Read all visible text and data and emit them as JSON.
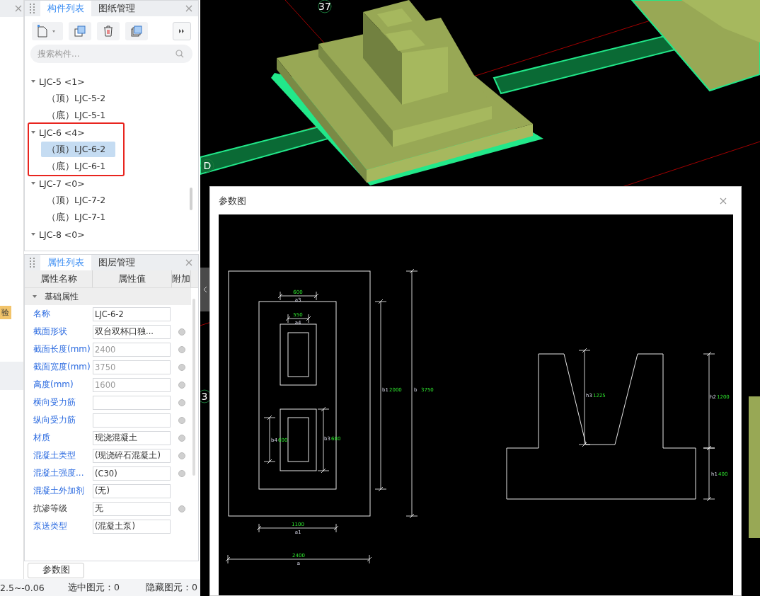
{
  "left_strip": {
    "badge": "验"
  },
  "component_panel": {
    "tabs": [
      {
        "label": "构件列表",
        "selected": true
      },
      {
        "label": "图纸管理",
        "selected": false
      }
    ],
    "search": {
      "placeholder": "搜索构件..."
    },
    "tree": [
      {
        "label": "LJC-5 <1>",
        "expanded": true,
        "marked": false,
        "children": [
          {
            "label": "（顶）LJC-5-2",
            "selected": false
          },
          {
            "label": "（底）LJC-5-1",
            "selected": false
          }
        ]
      },
      {
        "label": "LJC-6 <4>",
        "expanded": true,
        "marked": true,
        "children": [
          {
            "label": "（顶）LJC-6-2",
            "selected": true
          },
          {
            "label": "（底）LJC-6-1",
            "selected": false
          }
        ]
      },
      {
        "label": "LJC-7 <0>",
        "expanded": true,
        "marked": false,
        "children": [
          {
            "label": "（顶）LJC-7-2",
            "selected": false
          },
          {
            "label": "（底）LJC-7-1",
            "selected": false
          }
        ]
      },
      {
        "label": "LJC-8 <0>",
        "expanded": true,
        "marked": false
      }
    ]
  },
  "property_panel": {
    "tabs": [
      {
        "label": "属性列表",
        "selected": true
      },
      {
        "label": "图层管理",
        "selected": false
      }
    ],
    "columns": [
      "属性名称",
      "属性值",
      "附加"
    ],
    "group": {
      "label": "基础属性",
      "expanded": true
    },
    "rows": [
      {
        "name": "名称",
        "value": "LJC-6-2",
        "public": true,
        "disabled": false,
        "attached": false
      },
      {
        "name": "截面形状",
        "value": "双台双杯口独...",
        "public": true,
        "disabled": false,
        "attached": true
      },
      {
        "name": "截面长度(mm)",
        "value": "2400",
        "public": true,
        "disabled": true,
        "attached": true
      },
      {
        "name": "截面宽度(mm)",
        "value": "3750",
        "public": true,
        "disabled": true,
        "attached": true
      },
      {
        "name": "高度(mm)",
        "value": "1600",
        "public": true,
        "disabled": true,
        "attached": true
      },
      {
        "name": "横向受力筋",
        "public": true,
        "disabled": false,
        "attached": true
      },
      {
        "name": "纵向受力筋",
        "public": true,
        "disabled": false,
        "attached": true
      },
      {
        "name": "材质",
        "value": "现浇混凝土",
        "public": true,
        "disabled": false,
        "attached": true
      },
      {
        "name": "混凝土类型",
        "value": "(现浇碎石混凝土)",
        "public": true,
        "disabled": false,
        "attached": true
      },
      {
        "name": "混凝土强度...",
        "value": "(C30)",
        "public": true,
        "disabled": false,
        "attached": true
      },
      {
        "name": "混凝土外加剂",
        "value": "(无)",
        "public": true,
        "disabled": false,
        "attached": false
      },
      {
        "name": "抗渗等级",
        "value": "无",
        "public": false,
        "disabled": false,
        "attached": true
      },
      {
        "name": "泵送类型",
        "value": "(混凝土泵)",
        "public": true,
        "disabled": false,
        "attached": false
      }
    ],
    "button": "参数图"
  },
  "status_bar": [
    "2.5~-0.06",
    "选中图元：0",
    "隐藏图元：0"
  ],
  "viewport": {
    "axis_labels": [
      "37",
      "D",
      "3"
    ]
  },
  "dialog": {
    "title": "参数图",
    "plan_dimensions": [
      {
        "name": "a3",
        "value": "600"
      },
      {
        "name": "a4",
        "value": "550"
      },
      {
        "name": "b4",
        "value": "600"
      },
      {
        "name": "b3",
        "value": "680"
      },
      {
        "name": "b1",
        "value": "2000"
      },
      {
        "name": "b",
        "value": "3750"
      },
      {
        "name": "a1",
        "value": "1100"
      },
      {
        "name": "a",
        "value": "2400"
      }
    ],
    "section_dimensions": [
      {
        "name": "h3",
        "value": "1225"
      },
      {
        "name": "h2",
        "value": "1200"
      },
      {
        "name": "h1",
        "value": "400"
      }
    ]
  }
}
